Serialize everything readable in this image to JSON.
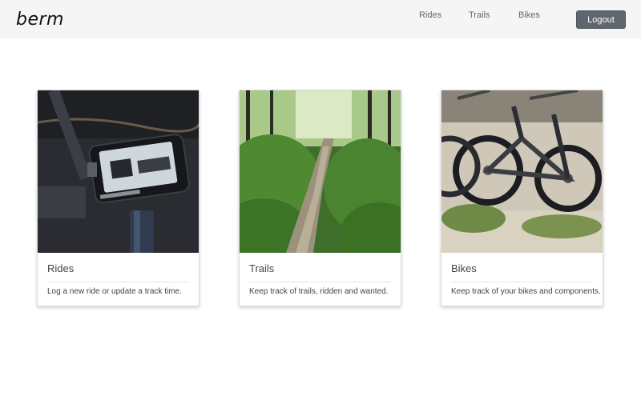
{
  "brand": "berm",
  "nav": {
    "rides": "Rides",
    "trails": "Trails",
    "bikes": "Bikes",
    "logout": "Logout"
  },
  "cards": [
    {
      "title": "Rides",
      "description": "Log a new ride or update a track time.",
      "icon": "bike-computer-photo"
    },
    {
      "title": "Trails",
      "description": "Keep track of trails, ridden and wanted.",
      "icon": "forest-trail-photo"
    },
    {
      "title": "Bikes",
      "description": "Keep track of your bikes and components.",
      "icon": "parked-bikes-photo"
    }
  ],
  "colors": {
    "header_bg": "#f5f5f5",
    "button_bg": "#5f6670",
    "text": "#444444"
  }
}
